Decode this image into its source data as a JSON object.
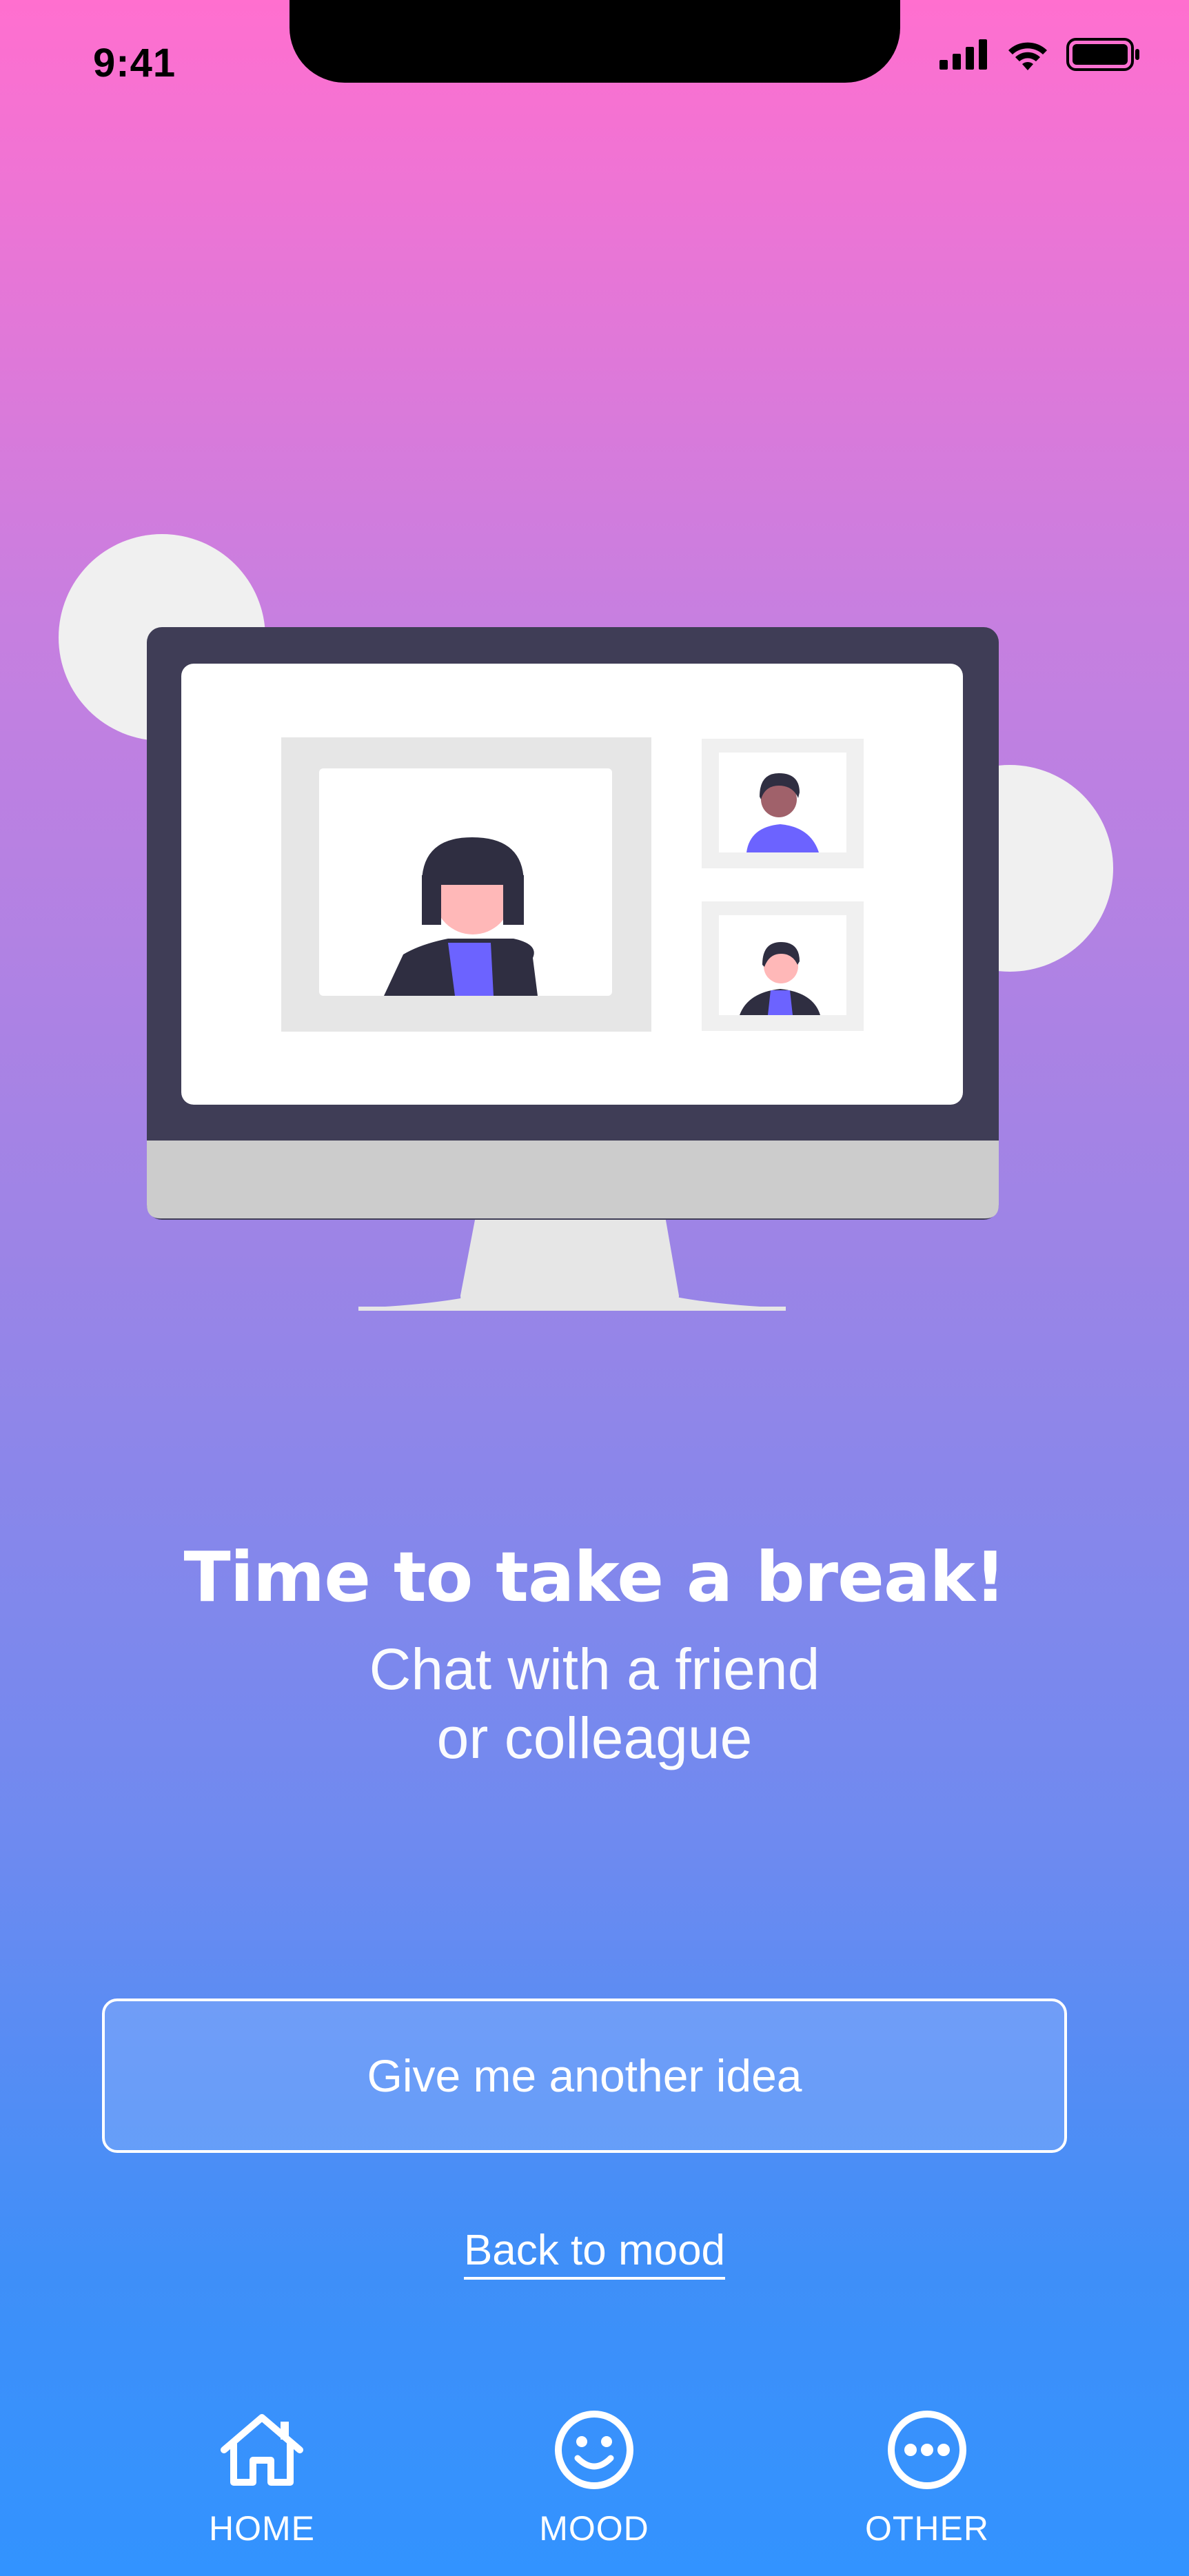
{
  "status_bar": {
    "time": "9:41"
  },
  "content": {
    "title": "Time to take a break!",
    "subtitle_line1": "Chat with a friend",
    "subtitle_line2": "or colleague"
  },
  "actions": {
    "another_idea_label": "Give me another idea",
    "back_label": "Back to mood"
  },
  "tabbar": {
    "tabs": [
      {
        "label": "HOME",
        "icon": "home-icon"
      },
      {
        "label": "MOOD",
        "icon": "smiley-icon"
      },
      {
        "label": "OTHER",
        "icon": "more-icon"
      }
    ]
  },
  "colors": {
    "gradient_top": "#ff6fcf",
    "gradient_bottom": "#3293ff",
    "monitor_frame": "#3f3d56",
    "accent_purple": "#6c63ff"
  }
}
